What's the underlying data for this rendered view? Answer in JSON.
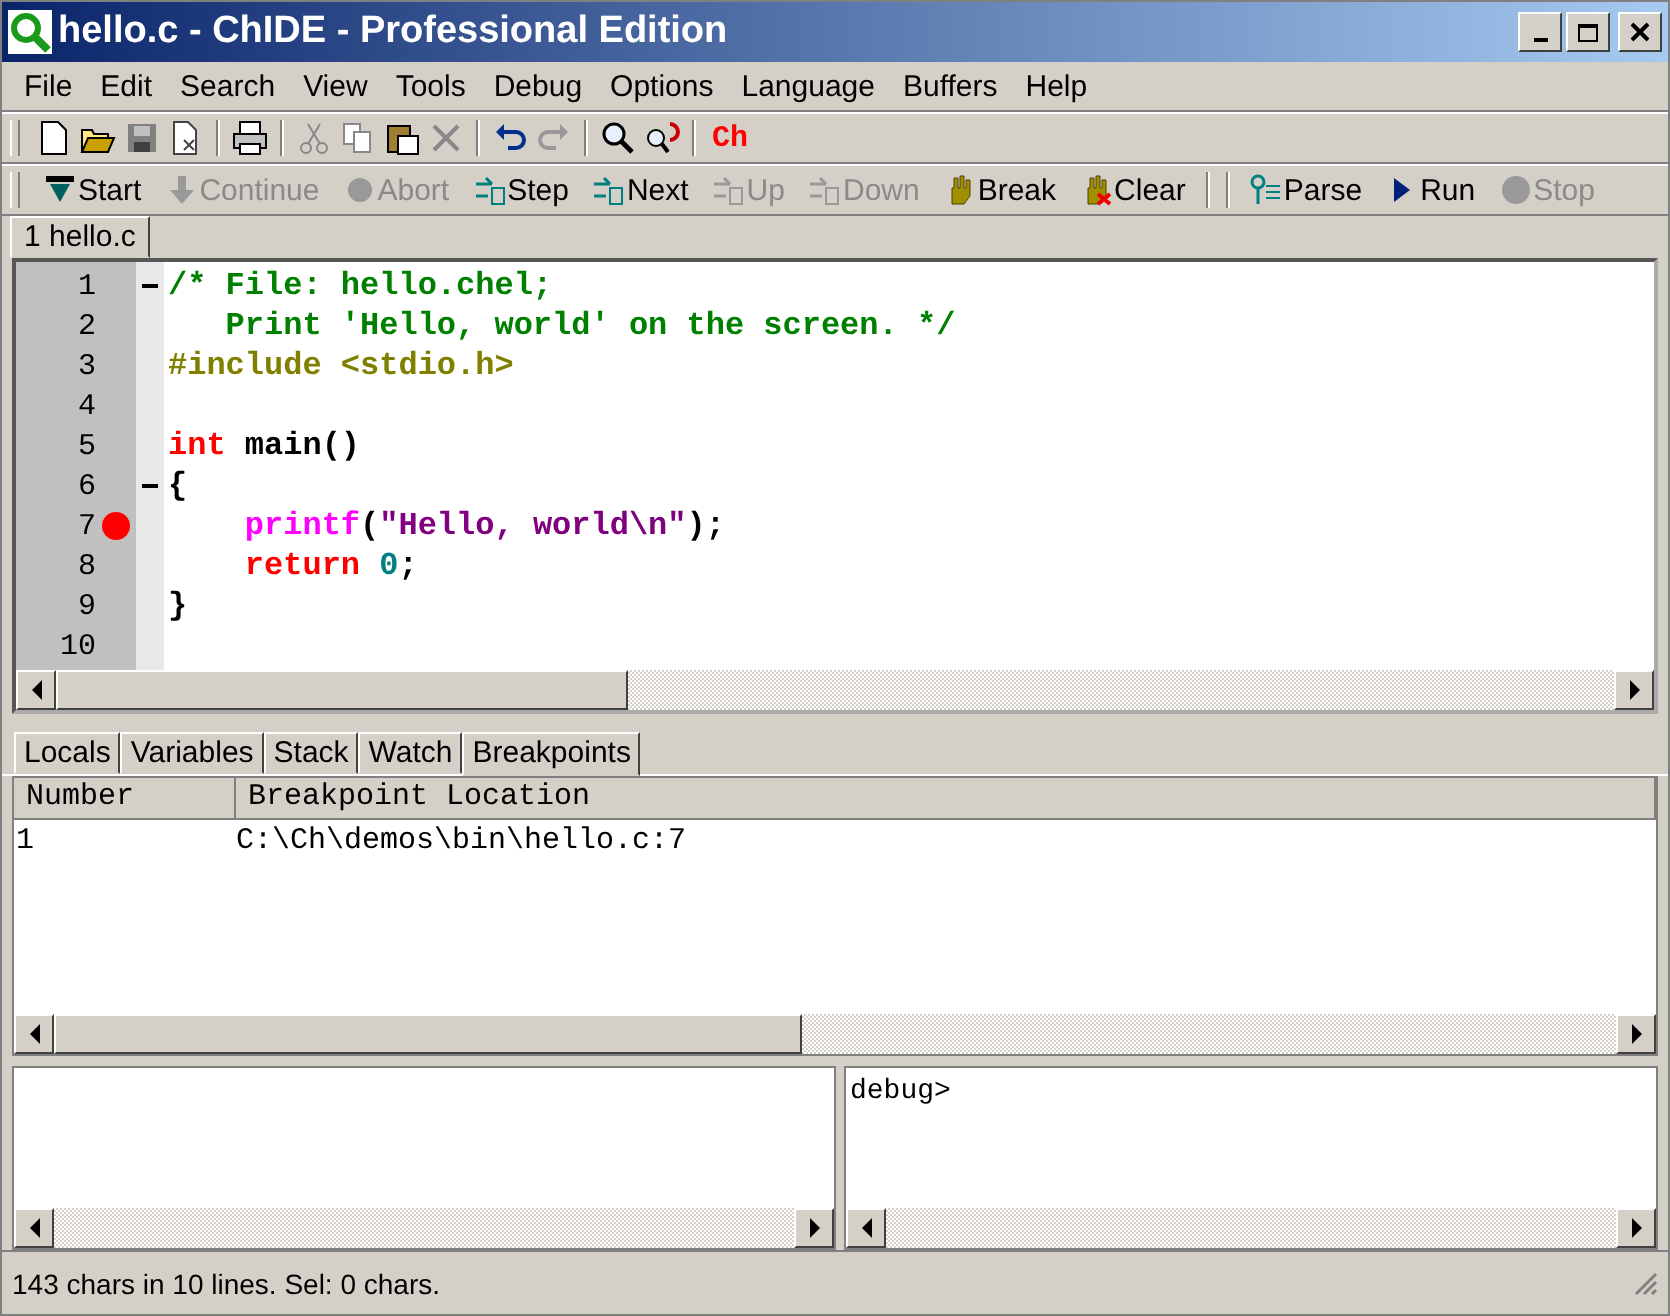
{
  "window": {
    "title": "hello.c - ChIDE - Professional Edition"
  },
  "menu": [
    "File",
    "Edit",
    "Search",
    "View",
    "Tools",
    "Debug",
    "Options",
    "Language",
    "Buffers",
    "Help"
  ],
  "toolbar": {
    "ch_label": "Ch"
  },
  "debug_toolbar": [
    {
      "label": "Start",
      "disabled": false
    },
    {
      "label": "Continue",
      "disabled": true
    },
    {
      "label": "Abort",
      "disabled": true
    },
    {
      "label": "Step",
      "disabled": false
    },
    {
      "label": "Next",
      "disabled": false
    },
    {
      "label": "Up",
      "disabled": true
    },
    {
      "label": "Down",
      "disabled": true
    },
    {
      "label": "Break",
      "disabled": false
    },
    {
      "label": "Clear",
      "disabled": false
    },
    {
      "label": "Parse",
      "disabled": false
    },
    {
      "label": "Run",
      "disabled": false
    },
    {
      "label": "Stop",
      "disabled": true
    }
  ],
  "file_tabs": [
    {
      "label": "1 hello.c",
      "selected": true
    }
  ],
  "editor": {
    "lines": [
      {
        "number": "1",
        "fold": true,
        "breakpoint": false,
        "tokens": [
          {
            "kind": "comment",
            "text": "/* File: hello.chel;"
          }
        ]
      },
      {
        "number": "2",
        "fold": false,
        "breakpoint": false,
        "tokens": [
          {
            "kind": "comment",
            "text": "   Print 'Hello, world' on the screen. */"
          }
        ]
      },
      {
        "number": "3",
        "fold": false,
        "breakpoint": false,
        "tokens": [
          {
            "kind": "preproc",
            "text": "#include <stdio.h>"
          }
        ]
      },
      {
        "number": "4",
        "fold": false,
        "breakpoint": false
      },
      {
        "number": "5",
        "fold": false,
        "breakpoint": false,
        "tokens": [
          {
            "kind": "keyword",
            "text": "int"
          },
          {
            "kind": "plain",
            "text": " main()"
          }
        ]
      },
      {
        "number": "6",
        "fold": true,
        "breakpoint": false,
        "tokens": [
          {
            "kind": "plain",
            "text": "{"
          }
        ]
      },
      {
        "number": "7",
        "fold": false,
        "breakpoint": true,
        "tokens": [
          {
            "kind": "function",
            "text": "    printf"
          },
          {
            "kind": "plain",
            "text": "("
          },
          {
            "kind": "string",
            "text": "\"Hello, world\\n\""
          },
          {
            "kind": "plain",
            "text": ");"
          }
        ]
      },
      {
        "number": "8",
        "fold": false,
        "breakpoint": false,
        "tokens": [
          {
            "kind": "keyword",
            "text": "    return"
          },
          {
            "kind": "number",
            "text": " 0"
          },
          {
            "kind": "plain",
            "text": ";"
          }
        ]
      },
      {
        "number": "9",
        "fold": false,
        "breakpoint": false,
        "tokens": [
          {
            "kind": "plain",
            "text": "}"
          }
        ]
      },
      {
        "number": "10",
        "fold": false,
        "breakpoint": false
      }
    ]
  },
  "debug_tabs": [
    {
      "label": "Locals",
      "selected": false
    },
    {
      "label": "Variables",
      "selected": false
    },
    {
      "label": "Stack",
      "selected": false
    },
    {
      "label": "Watch",
      "selected": false
    },
    {
      "label": "Breakpoints",
      "selected": true
    }
  ],
  "breakpoints": {
    "columns": [
      "Number",
      "Breakpoint Location"
    ],
    "rows": [
      [
        "1",
        "C:\\Ch\\demos\\bin\\hello.c:7"
      ]
    ]
  },
  "console": {
    "prompt": "debug>"
  },
  "status_bar": "143 chars in 10 lines. Sel: 0 chars."
}
